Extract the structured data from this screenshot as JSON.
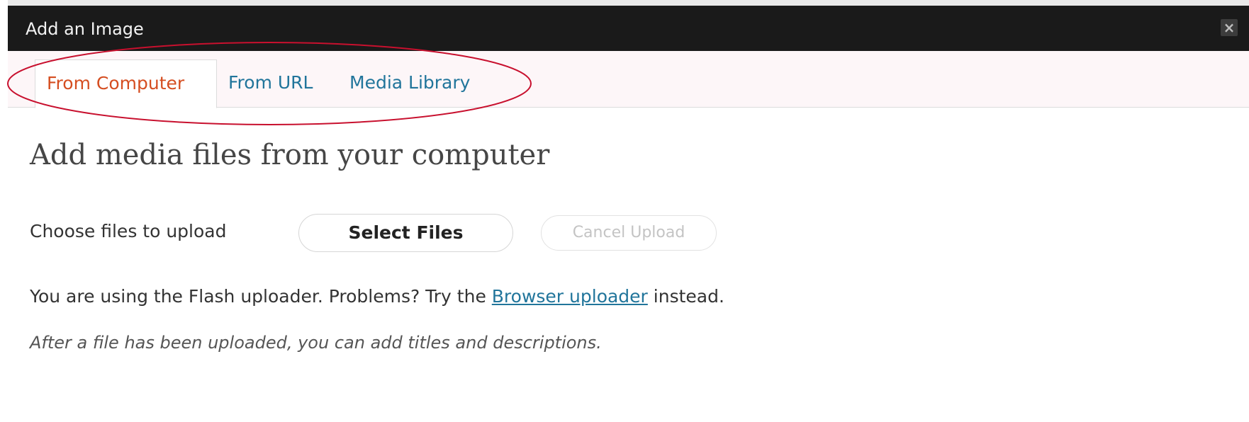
{
  "window": {
    "title": "Add an Image",
    "close_label": "×"
  },
  "tabs": [
    {
      "label": "From Computer",
      "active": true
    },
    {
      "label": "From URL",
      "active": false
    },
    {
      "label": "Media Library",
      "active": false
    }
  ],
  "main": {
    "heading": "Add media files from your computer",
    "upload_label": "Choose files to upload",
    "select_button": "Select Files",
    "cancel_button": "Cancel Upload",
    "flash_prefix": "You are using the Flash uploader. Problems? Try the ",
    "flash_link": "Browser uploader",
    "flash_suffix": " instead.",
    "after_upload_note": "After a file has been uploaded, you can add titles and descriptions."
  },
  "colors": {
    "titlebar": "#1a1a1a",
    "active_tab_text": "#d54e21",
    "link": "#21759b",
    "annotation": "#c8102e"
  }
}
